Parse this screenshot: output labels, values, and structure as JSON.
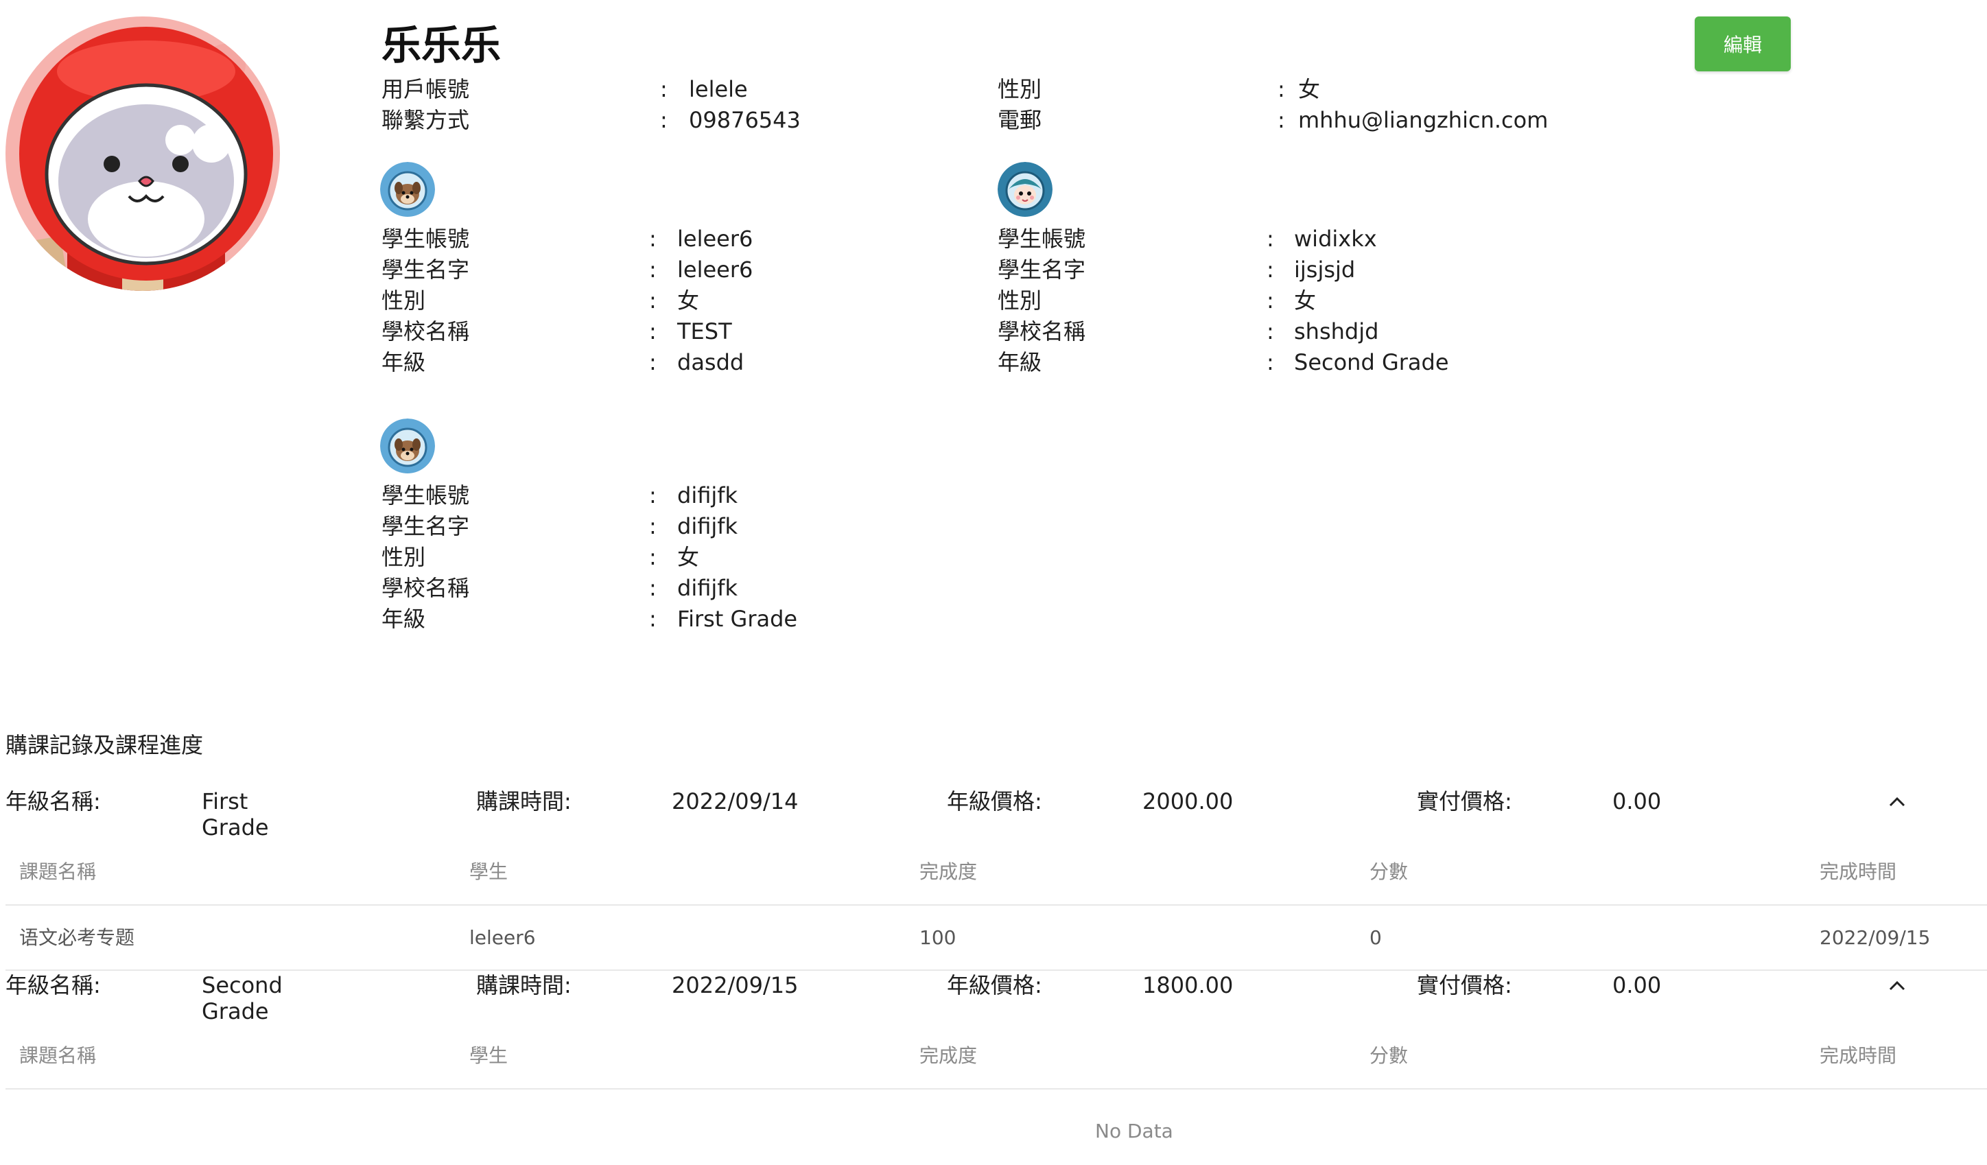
{
  "profile": {
    "name": "乐乐乐",
    "edit_label": "編輯",
    "fields_left": [
      {
        "label": "用戶帳號",
        "value": "lelele"
      },
      {
        "label": "聯繫方式",
        "value": "09876543"
      }
    ],
    "fields_right": [
      {
        "label": "性別",
        "value": "女"
      },
      {
        "label": "電郵",
        "value": "mhhu@liangzhicn.com"
      }
    ],
    "colon": ":"
  },
  "students": [
    {
      "avatar_icon": "dog-astronaut-icon",
      "fields": [
        {
          "label": "學生帳號",
          "value": "leleer6"
        },
        {
          "label": "學生名字",
          "value": "leleer6"
        },
        {
          "label": "性別",
          "value": "女"
        },
        {
          "label": "學校名稱",
          "value": "TEST"
        },
        {
          "label": "年級",
          "value": "dasdd"
        }
      ]
    },
    {
      "avatar_icon": "girl-astronaut-icon",
      "fields": [
        {
          "label": "學生帳號",
          "value": "widixkx"
        },
        {
          "label": "學生名字",
          "value": "ijsjsjd"
        },
        {
          "label": "性別",
          "value": "女"
        },
        {
          "label": "學校名稱",
          "value": "shshdjd"
        },
        {
          "label": "年級",
          "value": "Second Grade"
        }
      ]
    },
    {
      "avatar_icon": "dog-astronaut-icon",
      "fields": [
        {
          "label": "學生帳號",
          "value": "difijfk"
        },
        {
          "label": "學生名字",
          "value": "difijfk"
        },
        {
          "label": "性別",
          "value": "女"
        },
        {
          "label": "學校名稱",
          "value": "difijfk"
        },
        {
          "label": "年級",
          "value": "First Grade"
        }
      ]
    }
  ],
  "purchases": {
    "section_title": "購課記錄及課程進度",
    "labels": {
      "grade_name": "年級名稱:",
      "purchase_time": "購課時間:",
      "grade_price": "年級價格:",
      "paid_price": "實付價格:"
    },
    "columns": [
      "課題名稱",
      "學生",
      "完成度",
      "分數",
      "完成時間"
    ],
    "empty_text": "No Data",
    "records": [
      {
        "grade_line1": "First",
        "grade_line2": "Grade",
        "purchase_time": "2022/09/14",
        "grade_price": "2000.00",
        "paid_price": "0.00",
        "rows": [
          {
            "topic": "语文必考专题",
            "student": "leleer6",
            "completion": "100",
            "score": "0",
            "finish_time": "2022/09/15"
          }
        ]
      },
      {
        "grade_line1": "Second",
        "grade_line2": "Grade",
        "purchase_time": "2022/09/15",
        "grade_price": "1800.00",
        "paid_price": "0.00",
        "rows": []
      }
    ]
  }
}
